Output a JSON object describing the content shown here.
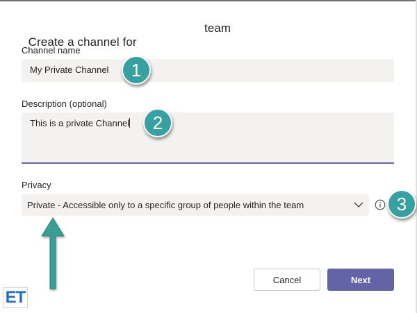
{
  "dialog": {
    "title_prefix": "Create a channel for",
    "title_suffix": "team"
  },
  "fields": {
    "channel_name_label": "Channel name",
    "channel_name_value": "My Private Channel",
    "description_label": "Description (optional)",
    "description_value": "This is a private Channel",
    "privacy_label": "Privacy",
    "privacy_value": "Private - Accessible only to a specific group of people within the team"
  },
  "buttons": {
    "cancel_label": "Cancel",
    "next_label": "Next"
  },
  "annotations": {
    "step1": "1",
    "step2": "2",
    "step3": "3",
    "badge_color": "#37a0a0",
    "arrow_color": "#3a9e93"
  },
  "logo": {
    "text": "ET",
    "color": "#1e6fd0"
  },
  "colors": {
    "accent": "#6264a7",
    "input_bg": "#f3f2f1"
  },
  "icons": {
    "dropdown": "chevron-down-icon",
    "info": "info-icon"
  }
}
